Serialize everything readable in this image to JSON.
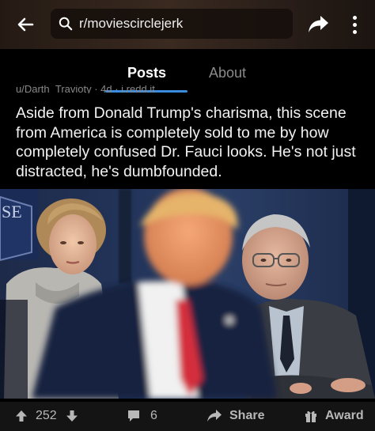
{
  "header": {
    "search_text": "r/moviescirclejerk"
  },
  "tabs": [
    {
      "label": "Posts",
      "active": true
    },
    {
      "label": "About",
      "active": false
    }
  ],
  "post": {
    "meta_cut": "u/Darth_Travioty · 4d · i.redd.it",
    "title": "Aside from Donald Trump's charisma, this scene from America is completely sold to me by how completely confused Dr. Fauci looks. He's not just distracted, he's dumbfounded.",
    "image_sign_text": "SE"
  },
  "actions": {
    "score": "252",
    "comments": "6",
    "share_label": "Share",
    "award_label": "Award"
  },
  "colors": {
    "accent": "#3a8dde",
    "background": "#000000",
    "action_bar": "#141414"
  }
}
